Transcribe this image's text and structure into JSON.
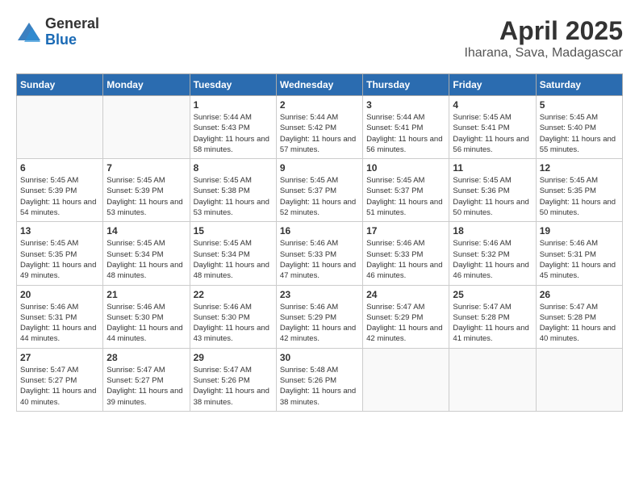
{
  "logo": {
    "general": "General",
    "blue": "Blue"
  },
  "title": "April 2025",
  "location": "Iharana, Sava, Madagascar",
  "weekdays": [
    "Sunday",
    "Monday",
    "Tuesday",
    "Wednesday",
    "Thursday",
    "Friday",
    "Saturday"
  ],
  "weeks": [
    [
      {
        "day": "",
        "sunrise": "",
        "sunset": "",
        "daylight": ""
      },
      {
        "day": "",
        "sunrise": "",
        "sunset": "",
        "daylight": ""
      },
      {
        "day": "1",
        "sunrise": "Sunrise: 5:44 AM",
        "sunset": "Sunset: 5:43 PM",
        "daylight": "Daylight: 11 hours and 58 minutes."
      },
      {
        "day": "2",
        "sunrise": "Sunrise: 5:44 AM",
        "sunset": "Sunset: 5:42 PM",
        "daylight": "Daylight: 11 hours and 57 minutes."
      },
      {
        "day": "3",
        "sunrise": "Sunrise: 5:44 AM",
        "sunset": "Sunset: 5:41 PM",
        "daylight": "Daylight: 11 hours and 56 minutes."
      },
      {
        "day": "4",
        "sunrise": "Sunrise: 5:45 AM",
        "sunset": "Sunset: 5:41 PM",
        "daylight": "Daylight: 11 hours and 56 minutes."
      },
      {
        "day": "5",
        "sunrise": "Sunrise: 5:45 AM",
        "sunset": "Sunset: 5:40 PM",
        "daylight": "Daylight: 11 hours and 55 minutes."
      }
    ],
    [
      {
        "day": "6",
        "sunrise": "Sunrise: 5:45 AM",
        "sunset": "Sunset: 5:39 PM",
        "daylight": "Daylight: 11 hours and 54 minutes."
      },
      {
        "day": "7",
        "sunrise": "Sunrise: 5:45 AM",
        "sunset": "Sunset: 5:39 PM",
        "daylight": "Daylight: 11 hours and 53 minutes."
      },
      {
        "day": "8",
        "sunrise": "Sunrise: 5:45 AM",
        "sunset": "Sunset: 5:38 PM",
        "daylight": "Daylight: 11 hours and 53 minutes."
      },
      {
        "day": "9",
        "sunrise": "Sunrise: 5:45 AM",
        "sunset": "Sunset: 5:37 PM",
        "daylight": "Daylight: 11 hours and 52 minutes."
      },
      {
        "day": "10",
        "sunrise": "Sunrise: 5:45 AM",
        "sunset": "Sunset: 5:37 PM",
        "daylight": "Daylight: 11 hours and 51 minutes."
      },
      {
        "day": "11",
        "sunrise": "Sunrise: 5:45 AM",
        "sunset": "Sunset: 5:36 PM",
        "daylight": "Daylight: 11 hours and 50 minutes."
      },
      {
        "day": "12",
        "sunrise": "Sunrise: 5:45 AM",
        "sunset": "Sunset: 5:35 PM",
        "daylight": "Daylight: 11 hours and 50 minutes."
      }
    ],
    [
      {
        "day": "13",
        "sunrise": "Sunrise: 5:45 AM",
        "sunset": "Sunset: 5:35 PM",
        "daylight": "Daylight: 11 hours and 49 minutes."
      },
      {
        "day": "14",
        "sunrise": "Sunrise: 5:45 AM",
        "sunset": "Sunset: 5:34 PM",
        "daylight": "Daylight: 11 hours and 48 minutes."
      },
      {
        "day": "15",
        "sunrise": "Sunrise: 5:45 AM",
        "sunset": "Sunset: 5:34 PM",
        "daylight": "Daylight: 11 hours and 48 minutes."
      },
      {
        "day": "16",
        "sunrise": "Sunrise: 5:46 AM",
        "sunset": "Sunset: 5:33 PM",
        "daylight": "Daylight: 11 hours and 47 minutes."
      },
      {
        "day": "17",
        "sunrise": "Sunrise: 5:46 AM",
        "sunset": "Sunset: 5:33 PM",
        "daylight": "Daylight: 11 hours and 46 minutes."
      },
      {
        "day": "18",
        "sunrise": "Sunrise: 5:46 AM",
        "sunset": "Sunset: 5:32 PM",
        "daylight": "Daylight: 11 hours and 46 minutes."
      },
      {
        "day": "19",
        "sunrise": "Sunrise: 5:46 AM",
        "sunset": "Sunset: 5:31 PM",
        "daylight": "Daylight: 11 hours and 45 minutes."
      }
    ],
    [
      {
        "day": "20",
        "sunrise": "Sunrise: 5:46 AM",
        "sunset": "Sunset: 5:31 PM",
        "daylight": "Daylight: 11 hours and 44 minutes."
      },
      {
        "day": "21",
        "sunrise": "Sunrise: 5:46 AM",
        "sunset": "Sunset: 5:30 PM",
        "daylight": "Daylight: 11 hours and 44 minutes."
      },
      {
        "day": "22",
        "sunrise": "Sunrise: 5:46 AM",
        "sunset": "Sunset: 5:30 PM",
        "daylight": "Daylight: 11 hours and 43 minutes."
      },
      {
        "day": "23",
        "sunrise": "Sunrise: 5:46 AM",
        "sunset": "Sunset: 5:29 PM",
        "daylight": "Daylight: 11 hours and 42 minutes."
      },
      {
        "day": "24",
        "sunrise": "Sunrise: 5:47 AM",
        "sunset": "Sunset: 5:29 PM",
        "daylight": "Daylight: 11 hours and 42 minutes."
      },
      {
        "day": "25",
        "sunrise": "Sunrise: 5:47 AM",
        "sunset": "Sunset: 5:28 PM",
        "daylight": "Daylight: 11 hours and 41 minutes."
      },
      {
        "day": "26",
        "sunrise": "Sunrise: 5:47 AM",
        "sunset": "Sunset: 5:28 PM",
        "daylight": "Daylight: 11 hours and 40 minutes."
      }
    ],
    [
      {
        "day": "27",
        "sunrise": "Sunrise: 5:47 AM",
        "sunset": "Sunset: 5:27 PM",
        "daylight": "Daylight: 11 hours and 40 minutes."
      },
      {
        "day": "28",
        "sunrise": "Sunrise: 5:47 AM",
        "sunset": "Sunset: 5:27 PM",
        "daylight": "Daylight: 11 hours and 39 minutes."
      },
      {
        "day": "29",
        "sunrise": "Sunrise: 5:47 AM",
        "sunset": "Sunset: 5:26 PM",
        "daylight": "Daylight: 11 hours and 38 minutes."
      },
      {
        "day": "30",
        "sunrise": "Sunrise: 5:48 AM",
        "sunset": "Sunset: 5:26 PM",
        "daylight": "Daylight: 11 hours and 38 minutes."
      },
      {
        "day": "",
        "sunrise": "",
        "sunset": "",
        "daylight": ""
      },
      {
        "day": "",
        "sunrise": "",
        "sunset": "",
        "daylight": ""
      },
      {
        "day": "",
        "sunrise": "",
        "sunset": "",
        "daylight": ""
      }
    ]
  ]
}
